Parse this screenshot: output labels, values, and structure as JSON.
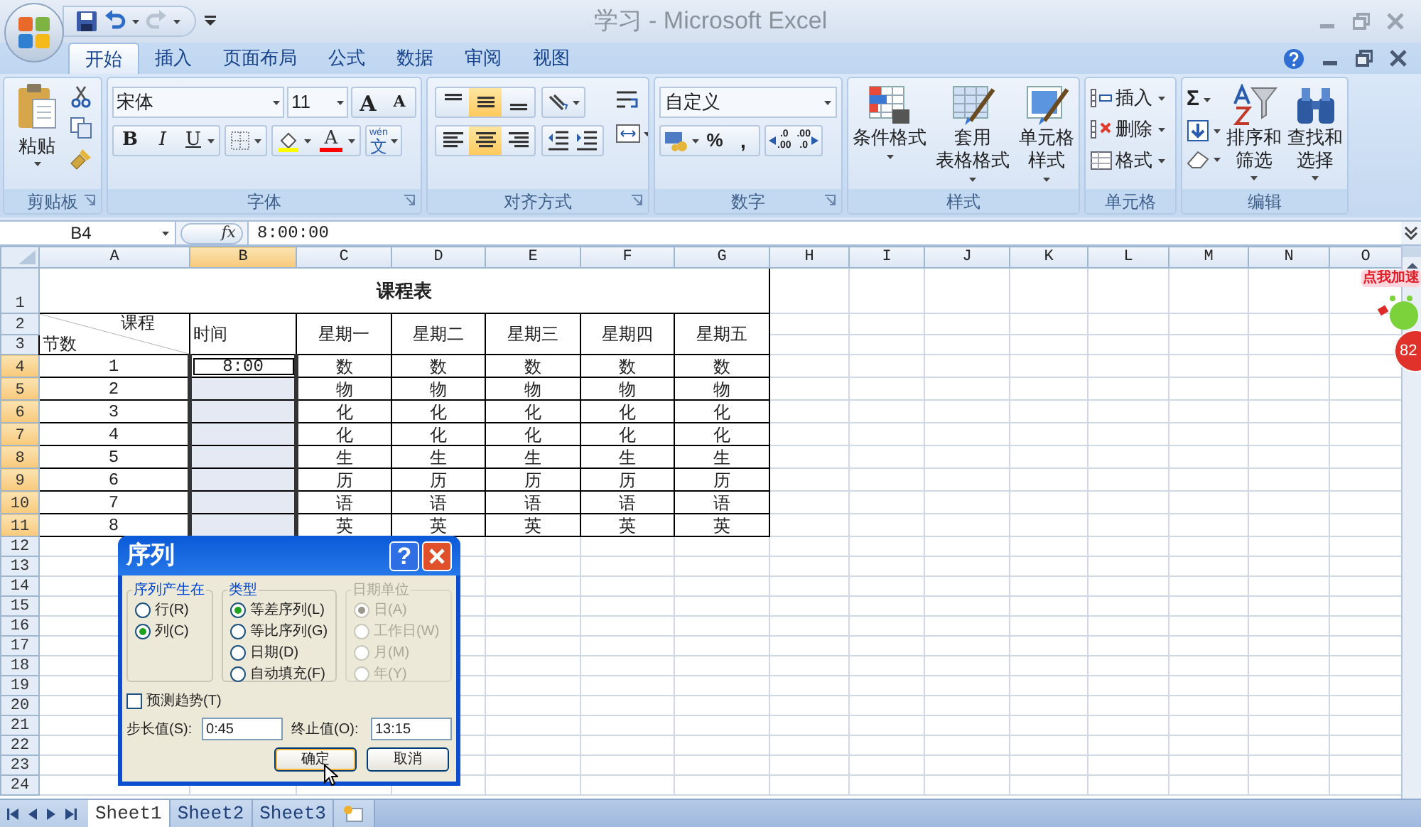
{
  "window": {
    "title": "学习 - Microsoft Excel"
  },
  "ribbon_tabs": [
    {
      "label": "开始",
      "selected": true
    },
    {
      "label": "插入",
      "selected": false
    },
    {
      "label": "页面布局",
      "selected": false
    },
    {
      "label": "公式",
      "selected": false
    },
    {
      "label": "数据",
      "selected": false
    },
    {
      "label": "审阅",
      "selected": false
    },
    {
      "label": "视图",
      "selected": false
    }
  ],
  "ribbon": {
    "clipboard": {
      "label": "剪贴板",
      "paste": "粘贴"
    },
    "font": {
      "label": "字体",
      "name": "宋体",
      "size": "11",
      "grow": "A",
      "shrink": "A",
      "bold": "B",
      "italic": "I",
      "underline": "U",
      "color_label": "A",
      "phonetic_top": "wén",
      "phonetic": "文"
    },
    "alignment": {
      "label": "对齐方式",
      "valign": [
        {
          "selected": false
        },
        {
          "selected": true
        },
        {
          "selected": false
        }
      ],
      "halign": [
        {
          "selected": false
        },
        {
          "selected": true
        },
        {
          "selected": false
        }
      ]
    },
    "number": {
      "label": "数字",
      "format": "自定义",
      "percent": "%",
      "comma": ",",
      "inc_decimal": [
        ".0",
        ".00"
      ],
      "dec_decimal": [
        ".00",
        ".0"
      ]
    },
    "styles": {
      "label": "样式",
      "buttons": [
        {
          "lines": [
            "条件格式"
          ]
        },
        {
          "lines": [
            "套用",
            "表格格式"
          ]
        },
        {
          "lines": [
            "单元格",
            "样式"
          ]
        }
      ]
    },
    "cells": {
      "label": "单元格",
      "buttons": [
        "插入",
        "删除",
        "格式"
      ]
    },
    "editing": {
      "label": "编辑",
      "sum": "Σ",
      "buttons": [
        {
          "lines": [
            "排序和",
            "筛选"
          ]
        },
        {
          "lines": [
            "查找和",
            "选择"
          ]
        }
      ]
    }
  },
  "formula_bar": {
    "name_box": "B4",
    "fx": "fx",
    "formula": "8:00:00"
  },
  "sheet": {
    "columns": [
      {
        "label": "A",
        "selected": false
      },
      {
        "label": "B",
        "selected": true
      },
      {
        "label": "C",
        "selected": false
      },
      {
        "label": "D",
        "selected": false
      },
      {
        "label": "E",
        "selected": false
      },
      {
        "label": "F",
        "selected": false
      },
      {
        "label": "G",
        "selected": false
      },
      {
        "label": "H",
        "selected": false
      },
      {
        "label": "I",
        "selected": false
      },
      {
        "label": "J",
        "selected": false
      },
      {
        "label": "K",
        "selected": false
      },
      {
        "label": "L",
        "selected": false
      },
      {
        "label": "M",
        "selected": false
      },
      {
        "label": "N",
        "selected": false
      },
      {
        "label": "O",
        "selected": false
      }
    ],
    "rows": [
      {
        "label": "1",
        "selected": false
      },
      {
        "label": "2",
        "selected": false
      },
      {
        "label": "3",
        "selected": false
      },
      {
        "label": "4",
        "selected": true
      },
      {
        "label": "5",
        "selected": true
      },
      {
        "label": "6",
        "selected": true
      },
      {
        "label": "7",
        "selected": true
      },
      {
        "label": "8",
        "selected": true
      },
      {
        "label": "9",
        "selected": true
      },
      {
        "label": "10",
        "selected": true
      },
      {
        "label": "11",
        "selected": true
      },
      {
        "label": "12",
        "selected": false
      },
      {
        "label": "13",
        "selected": false
      },
      {
        "label": "14",
        "selected": false
      },
      {
        "label": "15",
        "selected": false
      },
      {
        "label": "16",
        "selected": false
      },
      {
        "label": "17",
        "selected": false
      },
      {
        "label": "18",
        "selected": false
      },
      {
        "label": "19",
        "selected": false
      },
      {
        "label": "20",
        "selected": false
      },
      {
        "label": "21",
        "selected": false
      },
      {
        "label": "22",
        "selected": false
      },
      {
        "label": "23",
        "selected": false
      },
      {
        "label": "24",
        "selected": false
      }
    ],
    "title": "课程表",
    "corner_top": "课程",
    "corner_bottom": "节数",
    "time_header": "时间",
    "days": [
      "星期一",
      "星期二",
      "星期三",
      "星期四",
      "星期五"
    ],
    "lessons": [
      {
        "number": "1",
        "time": "8:00",
        "selected": true,
        "active": true,
        "subjects": [
          "数",
          "数",
          "数",
          "数",
          "数"
        ]
      },
      {
        "number": "2",
        "selected": true,
        "active": false,
        "subjects": [
          "物",
          "物",
          "物",
          "物",
          "物"
        ]
      },
      {
        "number": "3",
        "selected": true,
        "active": false,
        "subjects": [
          "化",
          "化",
          "化",
          "化",
          "化"
        ]
      },
      {
        "number": "4",
        "selected": true,
        "active": false,
        "subjects": [
          "化",
          "化",
          "化",
          "化",
          "化"
        ]
      },
      {
        "number": "5",
        "selected": true,
        "active": false,
        "subjects": [
          "生",
          "生",
          "生",
          "生",
          "生"
        ]
      },
      {
        "number": "6",
        "selected": true,
        "active": false,
        "subjects": [
          "历",
          "历",
          "历",
          "历",
          "历"
        ]
      },
      {
        "number": "7",
        "selected": true,
        "active": false,
        "subjects": [
          "语",
          "语",
          "语",
          "语",
          "语"
        ]
      },
      {
        "number": "8",
        "selected": true,
        "active": false,
        "subjects": [
          "英",
          "英",
          "英",
          "英",
          "英"
        ]
      }
    ]
  },
  "sheet_tabs": [
    {
      "label": "Sheet1",
      "selected": true
    },
    {
      "label": "Sheet2",
      "selected": false
    },
    {
      "label": "Sheet3",
      "selected": false
    }
  ],
  "dialog": {
    "title": "序列",
    "help": "?",
    "groups": [
      {
        "label": "序列产生在",
        "disabled": false,
        "options": [
          {
            "label": "行(R)",
            "selected": false
          },
          {
            "label": "列(C)",
            "selected": true
          }
        ]
      },
      {
        "label": "类型",
        "disabled": false,
        "options": [
          {
            "label": "等差序列(L)",
            "selected": true
          },
          {
            "label": "等比序列(G)",
            "selected": false
          },
          {
            "label": "日期(D)",
            "selected": false
          },
          {
            "label": "自动填充(F)",
            "selected": false
          }
        ]
      },
      {
        "label": "日期单位",
        "disabled": true,
        "options": [
          {
            "label": "日(A)",
            "selected": true
          },
          {
            "label": "工作日(W)",
            "selected": false
          },
          {
            "label": "月(M)",
            "selected": false
          },
          {
            "label": "年(Y)",
            "selected": false
          }
        ]
      }
    ],
    "trend": {
      "label": "预测趋势(T)",
      "checked": false
    },
    "step": {
      "label": "步长值(S):",
      "value": "0:45"
    },
    "stop": {
      "label": "终止值(O):",
      "value": "13:15"
    },
    "buttons": [
      {
        "label": "确定",
        "default": true
      },
      {
        "label": "取消",
        "default": false
      }
    ]
  },
  "widget": {
    "bubble": "点我加速",
    "badge": "82"
  }
}
